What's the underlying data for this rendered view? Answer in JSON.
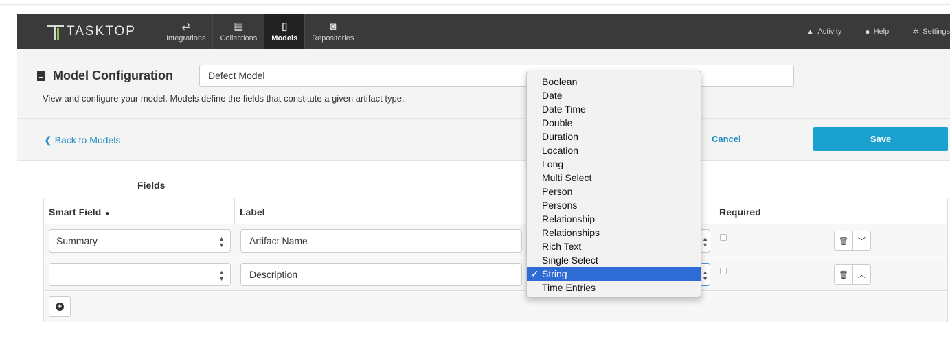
{
  "nav": {
    "logo_text": "TASKTOP",
    "tabs": [
      {
        "label": "Integrations",
        "icon": "exchange-icon"
      },
      {
        "label": "Collections",
        "icon": "archive-icon"
      },
      {
        "label": "Models",
        "icon": "document-icon"
      },
      {
        "label": "Repositories",
        "icon": "database-icon"
      }
    ],
    "active_tab": "Models",
    "right": [
      {
        "label": "Activity",
        "icon": "bell-icon"
      },
      {
        "label": "Help",
        "icon": "question-circle-icon"
      },
      {
        "label": "Settings",
        "icon": "gear-icon"
      }
    ]
  },
  "header": {
    "title": "Model Configuration",
    "model_name": "Defect Model",
    "description": "View and configure your model. Models define the fields that constitute a given artifact type."
  },
  "actions": {
    "back": "Back to Models",
    "cancel": "Cancel",
    "save": "Save"
  },
  "fields": {
    "title": "Fields",
    "columns": {
      "smart_field": "Smart Field",
      "label": "Label",
      "required": "Required"
    },
    "rows": [
      {
        "smart_field": "Summary",
        "label": "Artifact Name",
        "required": false,
        "toggle_icon": "chevron-down-icon"
      },
      {
        "smart_field": "",
        "label": "Description",
        "required": false,
        "toggle_icon": "chevron-up-icon"
      }
    ]
  },
  "type_dropdown": {
    "options": [
      "Boolean",
      "Date",
      "Date Time",
      "Double",
      "Duration",
      "Location",
      "Long",
      "Multi Select",
      "Person",
      "Persons",
      "Relationship",
      "Relationships",
      "Rich Text",
      "Single Select",
      "String",
      "Time Entries"
    ],
    "selected": "String",
    "check_mark": "✓"
  },
  "colors": {
    "nav_bg": "#3a3a3a",
    "accent": "#1aa1cf",
    "link": "#1d8cc4",
    "selected_option": "#2f6bd4",
    "logo_green": "#8bc34a"
  }
}
